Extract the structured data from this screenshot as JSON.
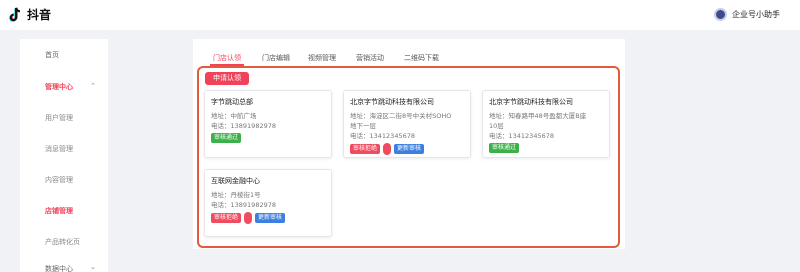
{
  "header": {
    "logo_text": "抖音",
    "assistant_label": "企业号小助手"
  },
  "sidebar": {
    "items": [
      {
        "label": "首页"
      },
      {
        "label": "管理中心"
      },
      {
        "label": "用户管理"
      },
      {
        "label": "消息管理"
      },
      {
        "label": "内容管理"
      },
      {
        "label": "店铺管理"
      },
      {
        "label": "产品转化页"
      },
      {
        "label": "数据中心"
      }
    ]
  },
  "tabs": [
    {
      "label": "门店认领"
    },
    {
      "label": "门店编辑"
    },
    {
      "label": "视频管理"
    },
    {
      "label": "营销活动"
    },
    {
      "label": "二维码下载"
    }
  ],
  "apply_button": "申请认领",
  "stores": [
    {
      "name": "字节跳动总部",
      "address": "地址：中航广场",
      "phone": "电话：13891982978",
      "badges": [
        {
          "text": "审核通过",
          "color": "#3cb14a"
        }
      ]
    },
    {
      "name": "北京字节跳动科技有限公司",
      "address_line1": "地址：海淀区二街8号中关村SOHO",
      "address_line2": "地下一层",
      "phone": "电话：13412345678",
      "badges": [
        {
          "text": "审核拒绝",
          "color": "#ef4d5f"
        },
        {
          "text": "更新审核",
          "color": "#3d7fe0"
        }
      ]
    },
    {
      "name": "北京字节跳动科技有限公司",
      "address_line1": "地址：知春路甲48号盈都大厦B座",
      "address_line2": "10层",
      "phone": "电话：13412345678",
      "badges": [
        {
          "text": "审核通过",
          "color": "#3cb14a"
        }
      ]
    },
    {
      "name": "互联网金融中心",
      "address": "地址：丹棱街1号",
      "phone": "电话：13891982978",
      "badges": [
        {
          "text": "审核拒绝",
          "color": "#ef4d5f"
        },
        {
          "text": "更新审核",
          "color": "#3d7fe0"
        }
      ]
    }
  ],
  "colors": {
    "brand": "#f0435a",
    "panel_border": "#e55a3c"
  }
}
